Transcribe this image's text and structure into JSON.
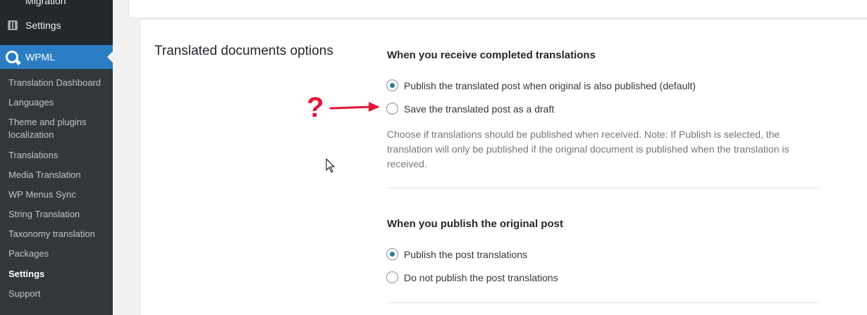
{
  "sidebar": {
    "migration_label": "Migration",
    "settings_label": "Settings",
    "wpml_label": "WPML",
    "items": [
      {
        "label": "Translation Dashboard"
      },
      {
        "label": "Languages"
      },
      {
        "label": "Theme and plugins localization"
      },
      {
        "label": "Translations"
      },
      {
        "label": "Media Translation"
      },
      {
        "label": "WP Menus Sync"
      },
      {
        "label": "String Translation"
      },
      {
        "label": "Taxonomy translation"
      },
      {
        "label": "Packages"
      },
      {
        "label": "Settings",
        "active": true
      },
      {
        "label": "Support"
      }
    ]
  },
  "main": {
    "section_title": "Translated documents options",
    "completed": {
      "heading": "When you receive completed translations",
      "options": [
        {
          "label": "Publish the translated post when original is also published (default)",
          "selected": true
        },
        {
          "label": "Save the translated post as a draft",
          "selected": false
        }
      ],
      "description": "Choose if translations should be published when received. Note: If Publish is selected, the translation will only be published if the original document is published when the translation is received."
    },
    "publish_original": {
      "heading": "When you publish the original post",
      "options": [
        {
          "label": "Publish the post translations",
          "selected": true
        },
        {
          "label": "Do not publish the post translations",
          "selected": false
        }
      ]
    }
  },
  "annotation": {
    "question_mark": "?",
    "color": "#e0153a"
  }
}
